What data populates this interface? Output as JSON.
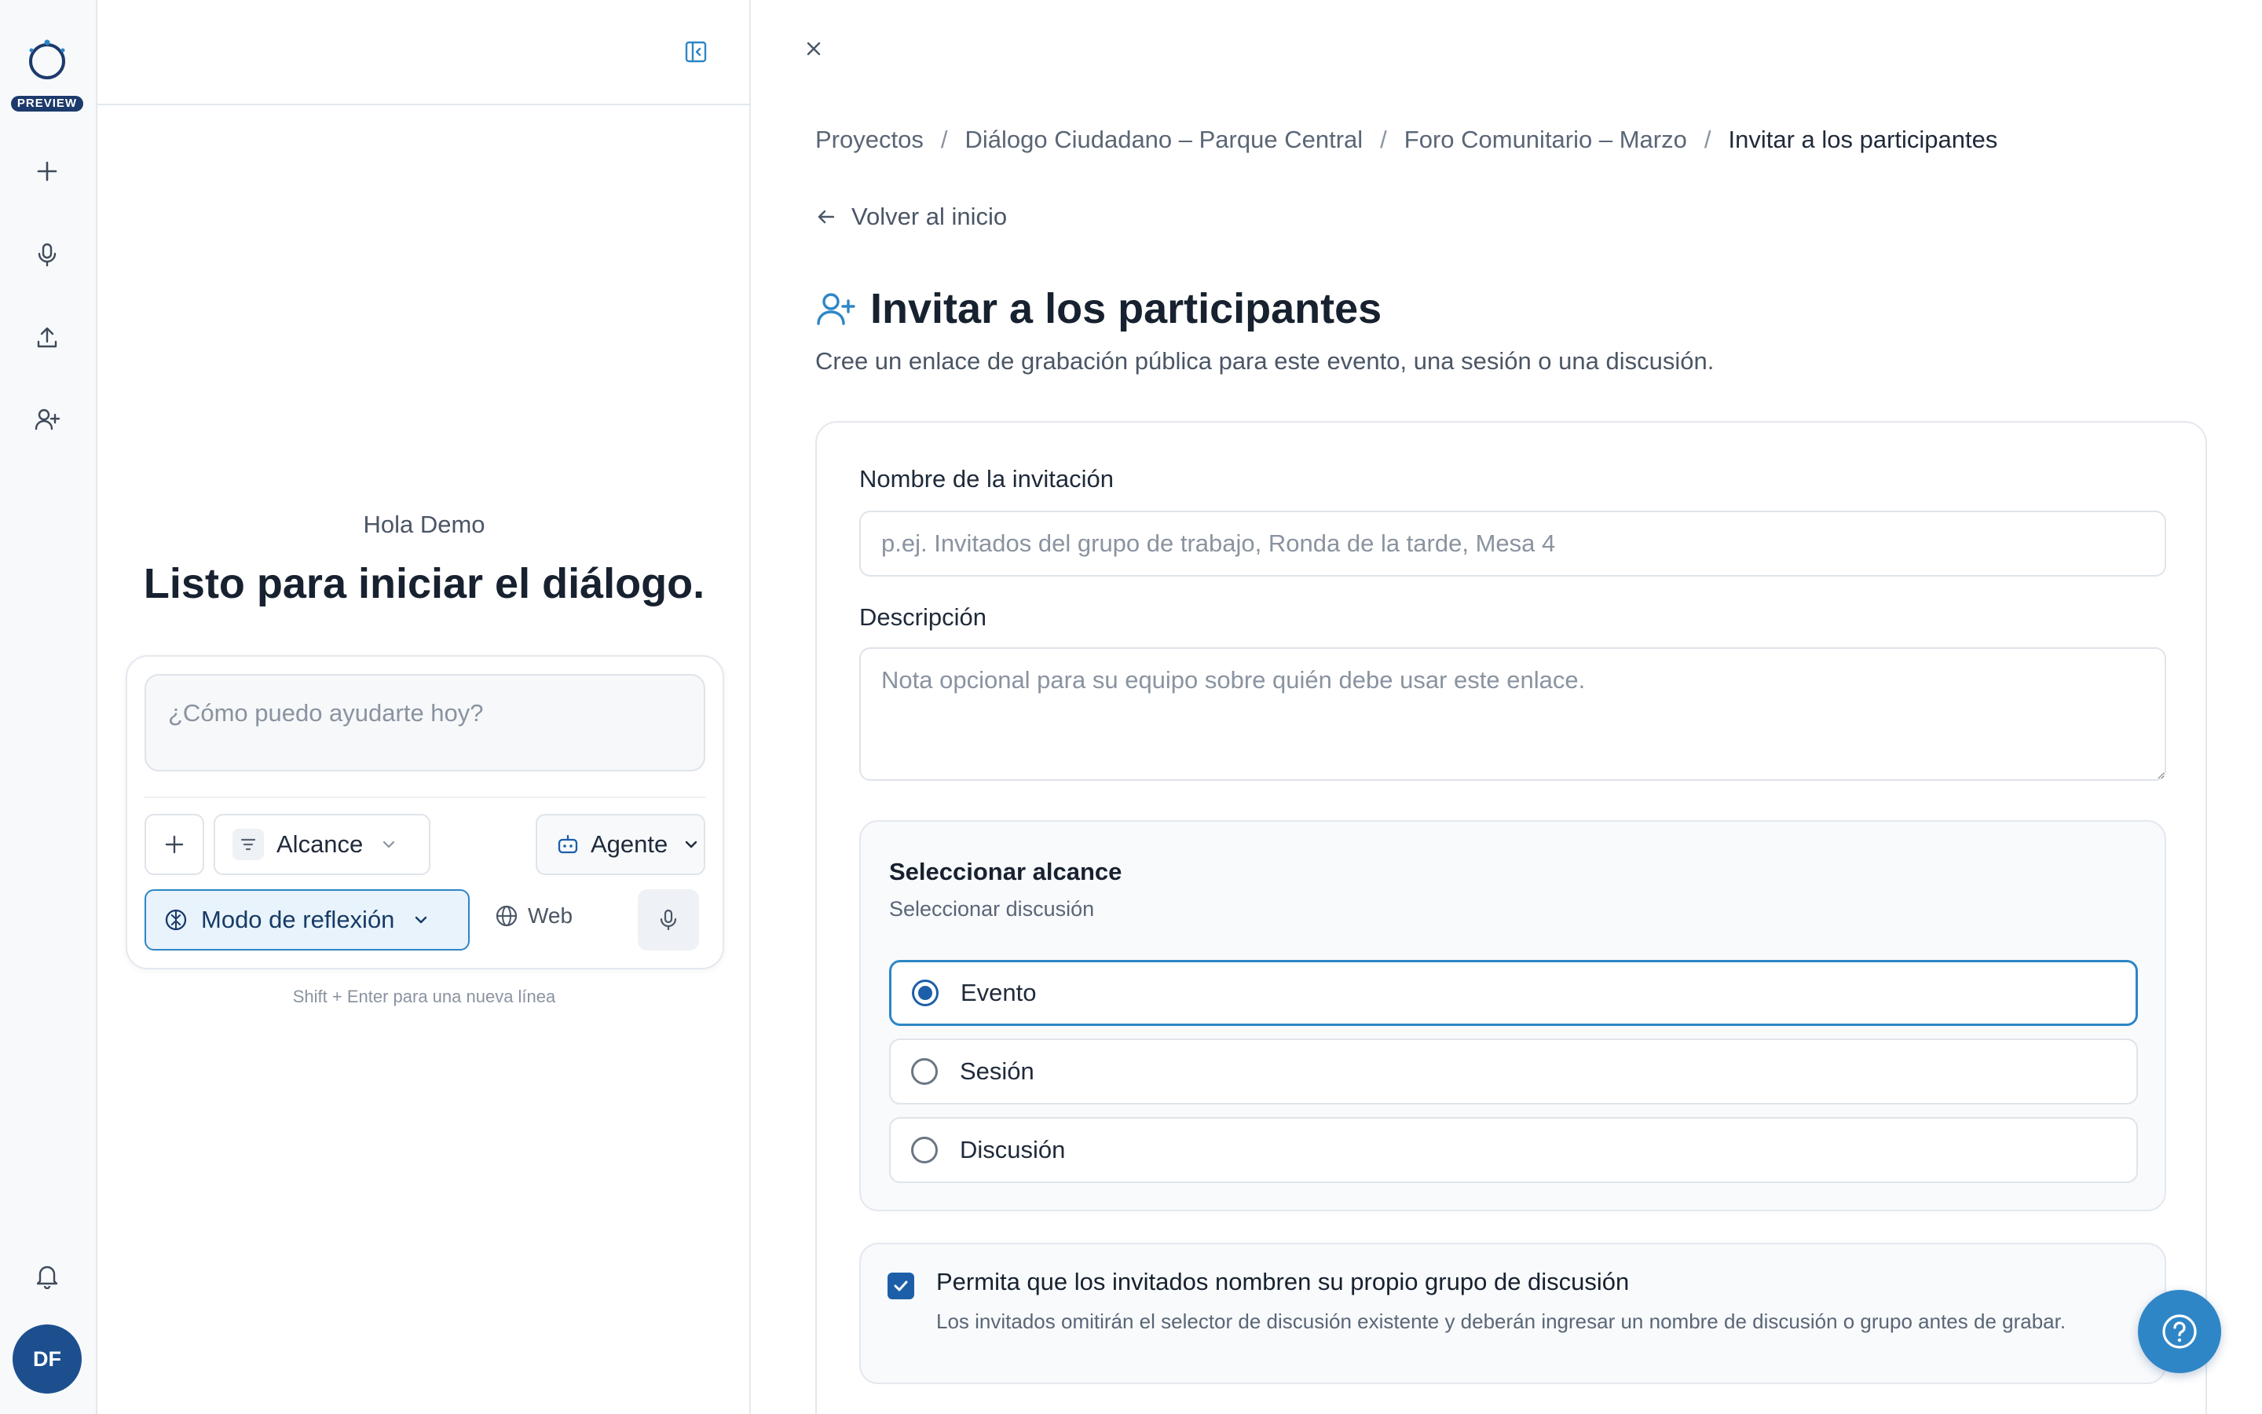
{
  "rail": {
    "badge": "PREVIEW",
    "avatar_initials": "DF",
    "items": [
      {
        "icon": "plus-icon"
      },
      {
        "icon": "microphone-icon"
      },
      {
        "icon": "upload-icon"
      },
      {
        "icon": "user-plus-icon"
      }
    ],
    "bottom_icon": "bell-icon"
  },
  "chat": {
    "greeting": "Hola Demo",
    "headline": "Listo para iniciar el diálogo.",
    "prompt_placeholder": "¿Cómo puedo ayudarte hoy?",
    "scope_label": "Alcance",
    "agent_label": "Agente",
    "reflection_label": "Modo de reflexión",
    "web_label": "Web",
    "hint": "Shift + Enter para una nueva línea"
  },
  "main": {
    "breadcrumb": [
      "Proyectos",
      "Diálogo Ciudadano – Parque Central",
      "Foro Comunitario – Marzo",
      "Invitar a los participantes"
    ],
    "back_label": "Volver al inicio",
    "title": "Invitar a los participantes",
    "subtitle": "Cree un enlace de grabación pública para este evento, una sesión o una discusión.",
    "form": {
      "name_label": "Nombre de la invitación",
      "name_placeholder": "p.ej. Invitados del grupo de trabajo, Ronda de la tarde, Mesa 4",
      "name_value": "",
      "desc_label": "Descripción",
      "desc_placeholder": "Nota opcional para su equipo sobre quién debe usar este enlace.",
      "scope_title": "Seleccionar alcance",
      "scope_subtitle": "Seleccionar discusión",
      "scope_options": [
        {
          "label": "Evento",
          "selected": true
        },
        {
          "label": "Sesión",
          "selected": false
        },
        {
          "label": "Discusión",
          "selected": false
        }
      ],
      "allow_title": "Permita que los invitados nombren su propio grupo de discusión",
      "allow_desc": "Los invitados omitirán el selector de discusión existente y deberán ingresar un nombre de discusión o grupo antes de grabar.",
      "allow_checked": true
    }
  },
  "colors": {
    "accent": "#2d86c5",
    "primary_dark": "#1c5fa8",
    "navy": "#1c3a6b",
    "help_button": "#2f86c6"
  }
}
